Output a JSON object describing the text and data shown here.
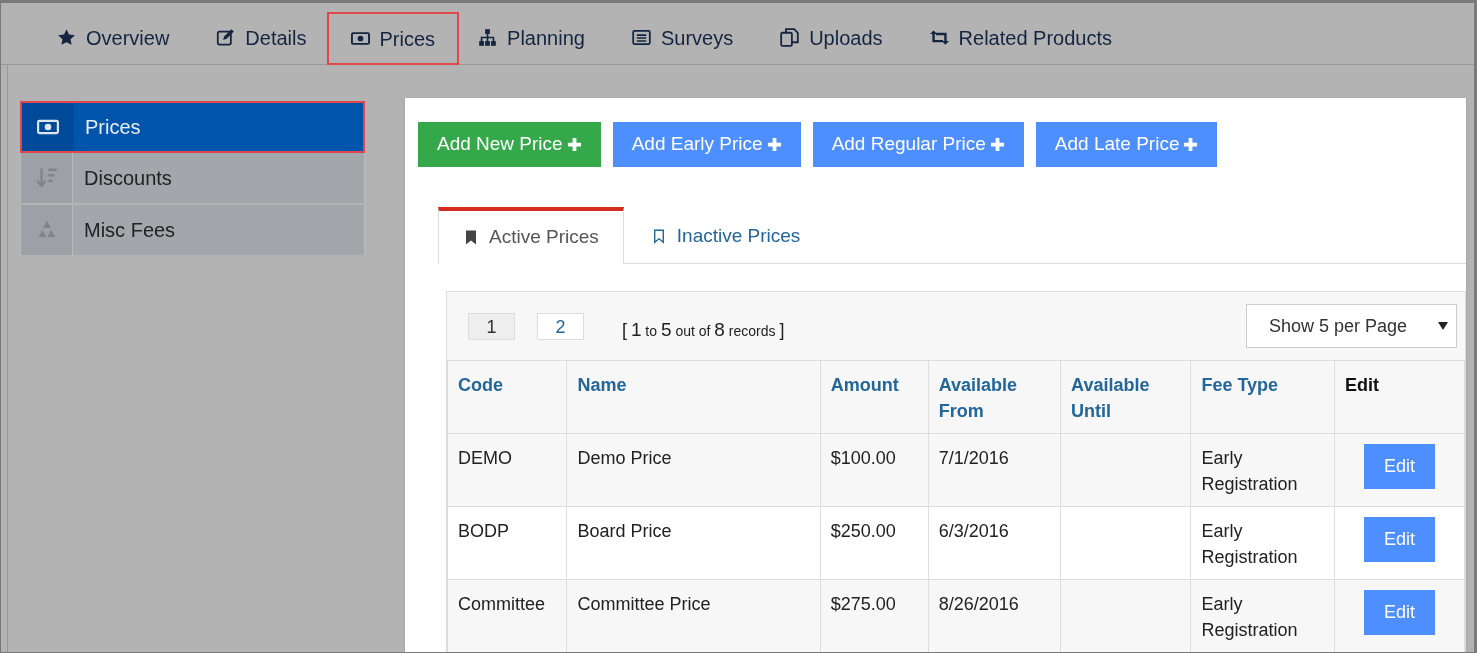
{
  "top_tabs": [
    {
      "label": "Overview",
      "selected": false
    },
    {
      "label": "Details",
      "selected": false
    },
    {
      "label": "Prices",
      "selected": true
    },
    {
      "label": "Planning",
      "selected": false
    },
    {
      "label": "Surveys",
      "selected": false
    },
    {
      "label": "Uploads",
      "selected": false
    },
    {
      "label": "Related Products",
      "selected": false
    }
  ],
  "sidebar": {
    "items": [
      {
        "label": "Prices",
        "selected": true
      },
      {
        "label": "Discounts",
        "selected": false
      },
      {
        "label": "Misc Fees",
        "selected": false
      }
    ]
  },
  "action_buttons": [
    {
      "label": "Add New Price",
      "kind": "primary"
    },
    {
      "label": "Add Early Price",
      "kind": "secondary"
    },
    {
      "label": "Add Regular Price",
      "kind": "secondary"
    },
    {
      "label": "Add Late Price",
      "kind": "secondary"
    }
  ],
  "price_tabs": [
    {
      "label": "Active Prices",
      "selected": true
    },
    {
      "label": "Inactive Prices",
      "selected": false
    }
  ],
  "pager": {
    "pages": [
      {
        "label": "1",
        "selected": true
      },
      {
        "label": "2",
        "selected": false
      }
    ],
    "records": "[ 1 to 5 out of 8 records ]",
    "page_size": "Show 5 per Page"
  },
  "table": {
    "columns": [
      {
        "label": "Code",
        "sortable": true
      },
      {
        "label": "Name",
        "sortable": true
      },
      {
        "label": "Amount",
        "sortable": true
      },
      {
        "label": "Available From",
        "sortable": true
      },
      {
        "label": "Available Until",
        "sortable": true
      },
      {
        "label": "Fee Type",
        "sortable": true
      },
      {
        "label": "Edit",
        "sortable": false
      }
    ],
    "rows": [
      {
        "cells": [
          "DEMO",
          "Demo Price",
          "$100.00",
          "7/1/2016",
          "",
          "Early Registration"
        ],
        "action": "Edit"
      },
      {
        "cells": [
          "BODP",
          "Board Price",
          "$250.00",
          "6/3/2016",
          "",
          "Early Registration"
        ],
        "action": "Edit"
      },
      {
        "cells": [
          "Committee",
          "Committee Price",
          "$275.00",
          "8/26/2016",
          "",
          "Early Registration"
        ],
        "action": "Edit"
      }
    ]
  }
}
